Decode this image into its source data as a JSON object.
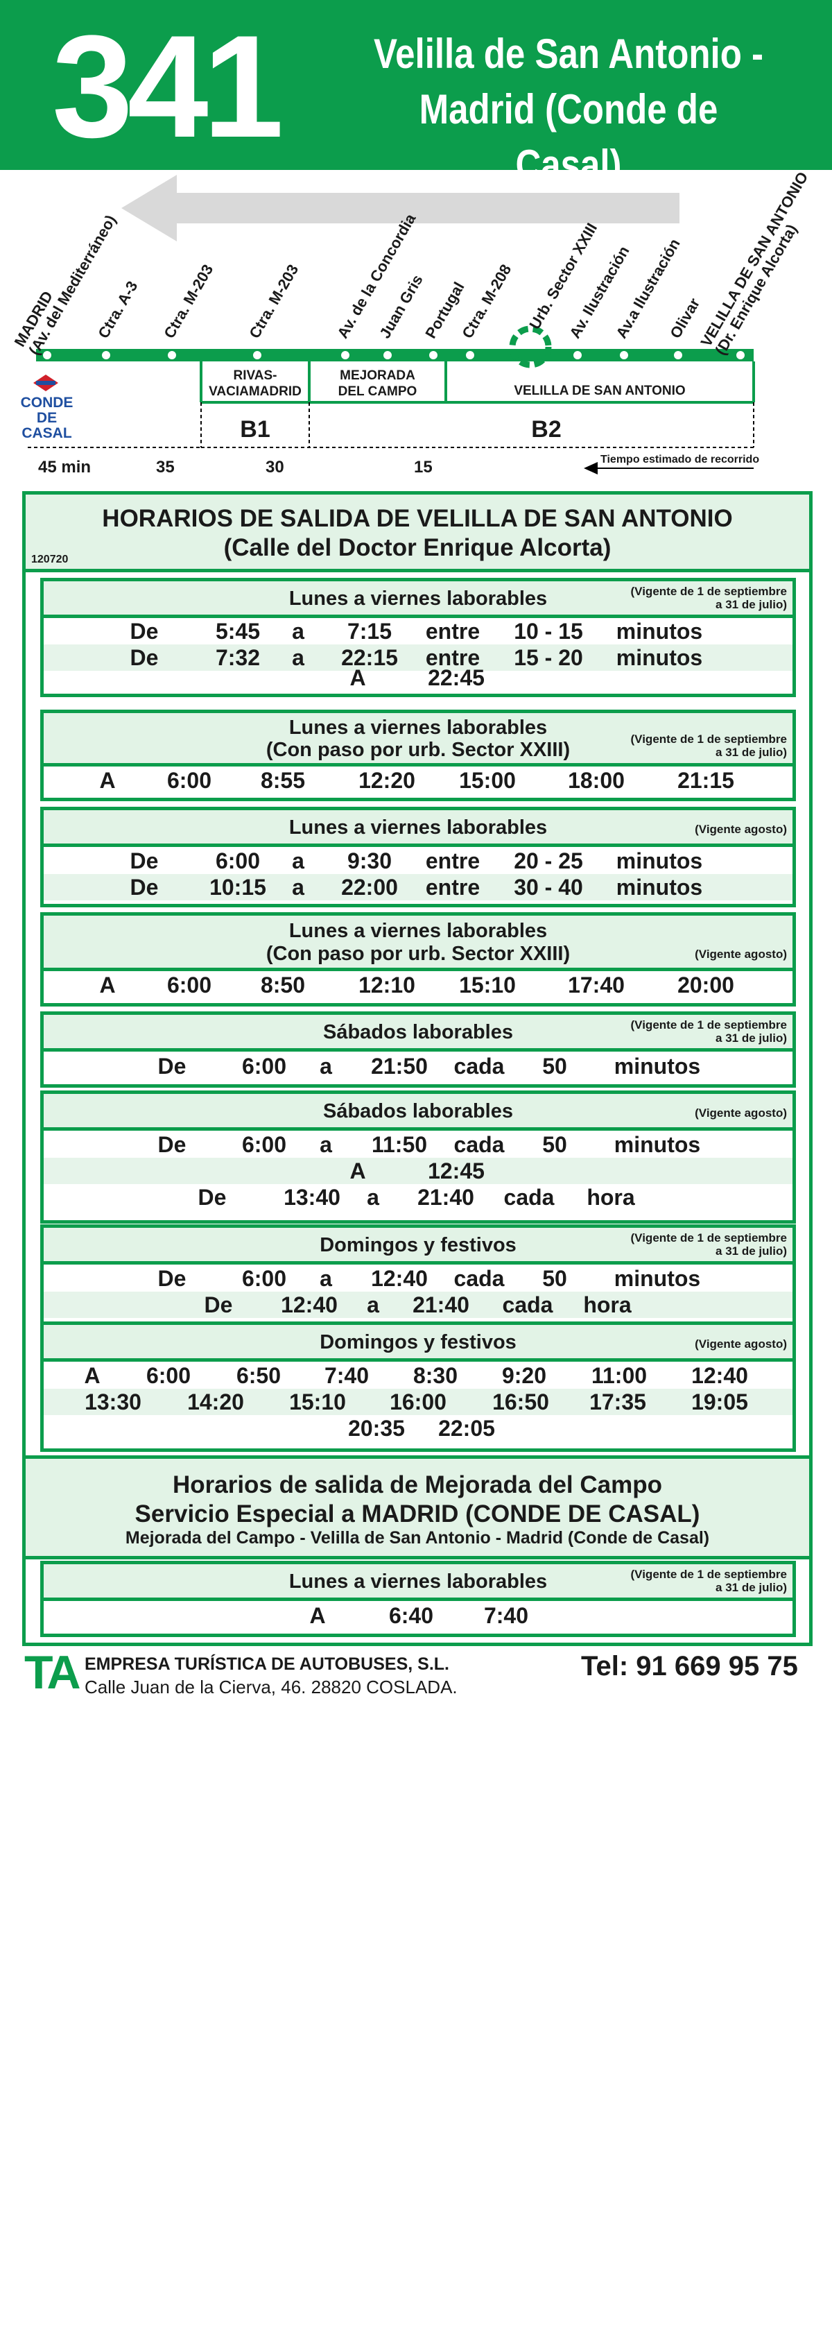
{
  "header": {
    "line_number": "341",
    "title_line1": "Velilla de San Antonio -",
    "title_line2": "Madrid (Conde de Casal)"
  },
  "route": {
    "stops": [
      {
        "name": "MADRID",
        "sub": "(Av. del Mediterráneo)"
      },
      {
        "name": "Ctra. A-3"
      },
      {
        "name": "Ctra. M-203"
      },
      {
        "name": "Ctra. M-203"
      },
      {
        "name": "Av. de la Concordia"
      },
      {
        "name": "Juan Gris"
      },
      {
        "name": "Portugal"
      },
      {
        "name": "Ctra. M-208"
      },
      {
        "name": "Urb. Sector XXIII"
      },
      {
        "name": "Av. Ilustración"
      },
      {
        "name": "Av.a Ilustración"
      },
      {
        "name": "Olivar"
      },
      {
        "name": "VELILLA DE SAN ANTONIO",
        "sub": "(Dr. Enrique Alcorta)"
      }
    ],
    "metro_label": "Metro",
    "terminal_label_1": "CONDE",
    "terminal_label_2": "DE CASAL",
    "zone_rivas_1": "RIVAS-",
    "zone_rivas_2": "VACIAMADRID",
    "zone_mejorada_1": "MEJORADA",
    "zone_mejorada_2": "DEL CAMPO",
    "zone_velilla": "VELILLA DE SAN ANTONIO",
    "fare_b1": "B1",
    "fare_b2": "B2",
    "times": [
      "45 min",
      "35",
      "30",
      "15"
    ],
    "time_note": "Tiempo estimado de recorrido"
  },
  "schedule": {
    "title_1": "HORARIOS DE SALIDA DE VELILLA DE SAN ANTONIO",
    "title_2": "(Calle del Doctor Enrique Alcorta)",
    "code": "120720",
    "p1": {
      "title": "Lunes a viernes laborables",
      "vig1": "(Vigente de 1 de septiembre",
      "vig2": "a 31 de julio)",
      "rows": [
        [
          "De",
          "5:45",
          "a",
          "7:15",
          "entre",
          "10 - 15",
          "minutos"
        ],
        [
          "De",
          "7:32",
          "a",
          "22:15",
          "entre",
          "15 - 20",
          "minutos"
        ],
        [
          "A",
          "22:45"
        ]
      ]
    },
    "p2": {
      "title1": "Lunes a viernes laborables",
      "title2": "(Con paso por urb. Sector XXIII)",
      "vig1": "(Vigente de 1 de septiembre",
      "vig2": "a 31 de julio)",
      "row": [
        "A",
        "6:00",
        "8:55",
        "12:20",
        "15:00",
        "18:00",
        "21:15"
      ]
    },
    "p3": {
      "title": "Lunes a viernes laborables",
      "vig": "(Vigente agosto)",
      "rows": [
        [
          "De",
          "6:00",
          "a",
          "9:30",
          "entre",
          "20 - 25",
          "minutos"
        ],
        [
          "De",
          "10:15",
          "a",
          "22:00",
          "entre",
          "30 - 40",
          "minutos"
        ]
      ]
    },
    "p4": {
      "title1": "Lunes a viernes laborables",
      "title2": "(Con paso por urb. Sector XXIII)",
      "vig": "(Vigente agosto)",
      "row": [
        "A",
        "6:00",
        "8:50",
        "12:10",
        "15:10",
        "17:40",
        "20:00"
      ]
    },
    "p5": {
      "title": "Sábados laborables",
      "vig1": "(Vigente de 1 de septiembre",
      "vig2": "a 31 de julio)",
      "row": [
        "De",
        "6:00",
        "a",
        "21:50",
        "cada",
        "50",
        "minutos"
      ]
    },
    "p6": {
      "title": "Sábados laborables",
      "vig": "(Vigente agosto)",
      "rows": [
        [
          "De",
          "6:00",
          "a",
          "11:50",
          "cada",
          "50",
          "minutos"
        ],
        [
          "A",
          "12:45"
        ],
        [
          "De",
          "13:40",
          "a",
          "21:40",
          "cada",
          "hora"
        ]
      ]
    },
    "p7": {
      "title": "Domingos y festivos",
      "vig1": "(Vigente de 1 de septiembre",
      "vig2": "a 31 de julio)",
      "rows": [
        [
          "De",
          "6:00",
          "a",
          "12:40",
          "cada",
          "50",
          "minutos"
        ],
        [
          "De",
          "12:40",
          "a",
          "21:40",
          "cada",
          "hora"
        ]
      ]
    },
    "p8": {
      "title": "Domingos y festivos",
      "vig": "(Vigente agosto)",
      "rows": [
        [
          "A",
          "6:00",
          "6:50",
          "7:40",
          "8:30",
          "9:20",
          "11:00",
          "12:40"
        ],
        [
          "13:30",
          "14:20",
          "15:10",
          "16:00",
          "16:50",
          "17:35",
          "19:05"
        ],
        [
          "20:35",
          "22:05"
        ]
      ]
    },
    "special": {
      "title1": "Horarios de salida de Mejorada del Campo",
      "title2": "Servicio Especial a MADRID (CONDE DE CASAL)",
      "title3": "Mejorada del Campo - Velilla de San Antonio - Madrid (Conde de Casal)"
    },
    "p9": {
      "title": "Lunes a viernes laborables",
      "vig1": "(Vigente de 1 de septiembre",
      "vig2": "a 31 de julio)",
      "row": [
        "A",
        "6:40",
        "7:40"
      ]
    }
  },
  "footer": {
    "logo": "TA",
    "company": "EMPRESA TURÍSTICA DE AUTOBUSES, S.L.",
    "address": "Calle Juan de la Cierva, 46. 28820 COSLADA.",
    "phone": "Tel: 91 669 95 75"
  },
  "colors": {
    "brand_green": "#0c9d4c",
    "light_green": "#e2f3e6",
    "arrow_gray": "#d9d9d9"
  }
}
